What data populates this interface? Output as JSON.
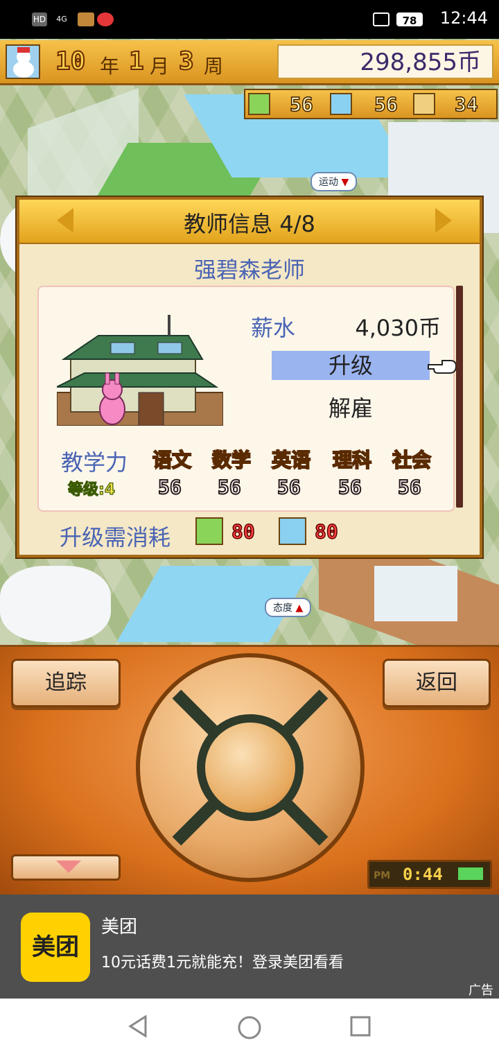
{
  "status_bar": {
    "left_chips": [
      "HD",
      "4G"
    ],
    "battery": "78",
    "time": "12:44"
  },
  "game_header": {
    "year": "10",
    "year_unit": "年",
    "month": "1",
    "month_unit": "月",
    "week": "3",
    "week_unit": "周",
    "money": "298,855币"
  },
  "resources": {
    "research_points": "56",
    "lab_points": "56",
    "lottery_points": "34"
  },
  "map_bubbles": {
    "sport": "运动",
    "attitude": "态度"
  },
  "dialog": {
    "title": "教师信息 4/8",
    "teacher_name": "强碧森老师",
    "salary_label": "薪水",
    "salary_value": "4,030币",
    "upgrade_label": "升级",
    "fire_label": "解雇",
    "teaching_label": "教学力",
    "level_label": "等级:",
    "level_value": "4",
    "subjects": [
      {
        "name": "语文",
        "value": "56"
      },
      {
        "name": "数学",
        "value": "56"
      },
      {
        "name": "英语",
        "value": "56"
      },
      {
        "name": "理科",
        "value": "56"
      },
      {
        "name": "社会",
        "value": "56"
      }
    ],
    "cost_label": "升级需消耗",
    "cost_research": "80",
    "cost_lab": "80"
  },
  "controls": {
    "track_label": "追踪",
    "back_label": "返回",
    "clock_ampm": "PM",
    "clock_time": "0:44"
  },
  "ad": {
    "logo_text": "美团",
    "title": "美团",
    "description": "10元话费1元就能充！登录美团看看",
    "badge": "广告"
  },
  "colors": {
    "accent_gold": "#e2a31c",
    "highlight_blue": "#9ab4f0",
    "label_blue": "#4a64b4",
    "ad_yellow": "#ffd100"
  }
}
